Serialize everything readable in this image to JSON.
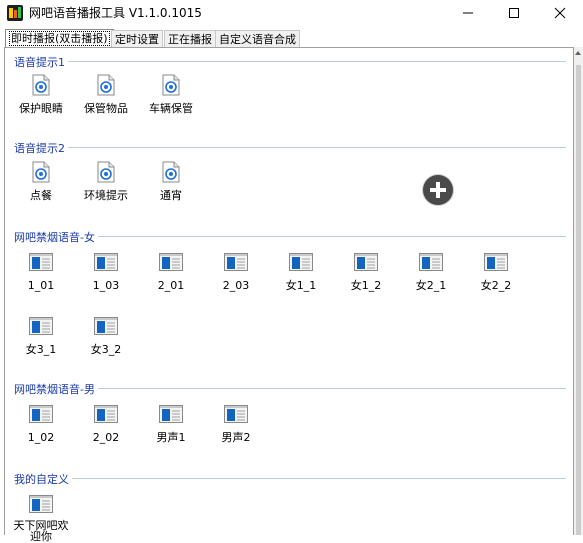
{
  "window": {
    "title": "网吧语音播报工具 V1.1.0.1015",
    "minimize_icon": "minimize-icon",
    "maximize_icon": "maximize-icon",
    "close_icon": "close-icon"
  },
  "tabs": [
    {
      "label": "即时播报(双击播报)",
      "active": true
    },
    {
      "label": "定时设置",
      "active": false
    },
    {
      "label": "正在播报",
      "active": false
    },
    {
      "label": "自定义语音合成",
      "active": false
    }
  ],
  "groups": [
    {
      "title": "语音提示1",
      "icon": "audio-file-icon",
      "items": [
        "保护眼睛",
        "保管物品",
        "车辆保管"
      ]
    },
    {
      "title": "语音提示2",
      "icon": "audio-file-icon",
      "items": [
        "点餐",
        "环境提示",
        "通宵"
      ]
    },
    {
      "title": "网吧禁烟语音-女",
      "icon": "media-file-icon",
      "items": [
        "1_01",
        "1_03",
        "2_01",
        "2_03",
        "女1_1",
        "女1_2",
        "女2_1",
        "女2_2",
        "女3_1",
        "女3_2"
      ]
    },
    {
      "title": "网吧禁烟语音-男",
      "icon": "media-file-icon",
      "items": [
        "1_02",
        "2_02",
        "男声1",
        "男声2"
      ]
    },
    {
      "title": "我的自定义",
      "icon": "media-file-icon",
      "items": [
        "天下网吧欢迎你"
      ]
    }
  ],
  "add_button_icon": "plus-icon",
  "colors": {
    "group_title": "#1a3aa8",
    "group_line": "#b9cde5",
    "audio_icon": "#1e6fd9",
    "media_icon": "#1565c0",
    "add_button": "#4a4a4a"
  }
}
